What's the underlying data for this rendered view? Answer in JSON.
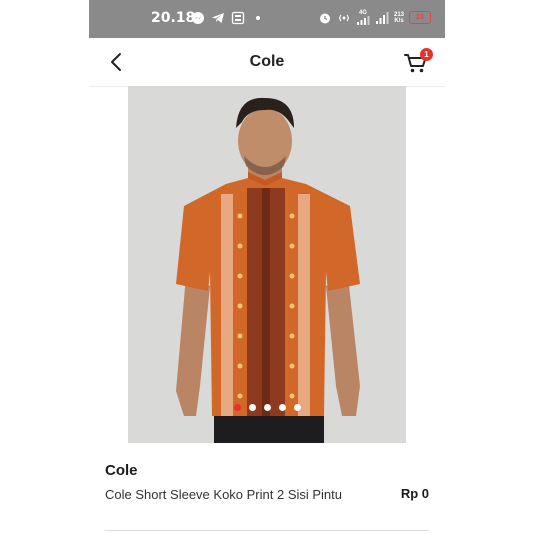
{
  "status_bar": {
    "time": "20.18",
    "network_label": "4G",
    "speed_value": "213",
    "speed_unit": "K/s",
    "battery": "23"
  },
  "app_bar": {
    "title": "Cole",
    "cart_count": "1"
  },
  "colors": {
    "accent": "#e5322d",
    "status_bar_bg": "#8a8a8a",
    "shirt": "#d2672a"
  },
  "product": {
    "brand": "Cole",
    "name": "Cole Short Sleeve Koko Print 2 Sisi Pintu",
    "price": "Rp 0",
    "image_count": 5,
    "active_image": 1
  }
}
